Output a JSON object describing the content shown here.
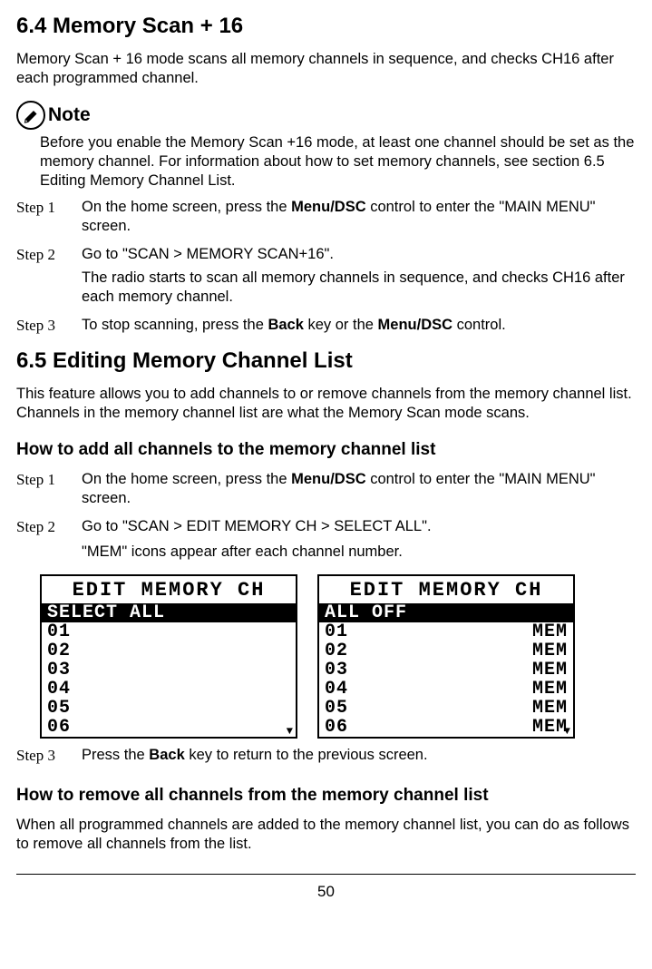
{
  "section64": {
    "heading": "6.4 Memory Scan + 16",
    "intro": "Memory Scan + 16 mode scans all memory channels in sequence, and checks CH16 after each programmed channel.",
    "note": {
      "label": "Note",
      "body": "Before you enable the Memory Scan +16 mode, at least one channel should be set as the memory channel. For information about how to set memory channels, see section 6.5 Editing Memory Channel List."
    },
    "steps": [
      {
        "label": "Step 1",
        "parts": [
          "On the home screen, press the ",
          "Menu/DSC",
          " control to enter the \"MAIN MENU\" screen."
        ]
      },
      {
        "label": "Step 2",
        "line1": "Go to \"SCAN > MEMORY SCAN+16\".",
        "line2": "The radio starts to scan all memory channels in sequence, and checks CH16 after each memory channel."
      },
      {
        "label": "Step 3",
        "parts": [
          "To stop scanning, press the ",
          "Back",
          " key or the ",
          "Menu/DSC",
          " control."
        ]
      }
    ]
  },
  "section65": {
    "heading": "6.5 Editing Memory Channel List",
    "intro": "This feature allows you to add channels to or remove channels from the memory channel list. Channels in the memory channel list are what the Memory Scan mode scans.",
    "addHeading": "How to add all channels to the memory channel list",
    "addSteps": [
      {
        "label": "Step 1",
        "parts": [
          "On the home screen, press the ",
          "Menu/DSC",
          " control to enter the \"MAIN MENU\" screen."
        ]
      },
      {
        "label": "Step 2",
        "line1": "Go to \"SCAN > EDIT MEMORY CH > SELECT ALL\".",
        "line2": "\"MEM\" icons appear after each channel number."
      }
    ],
    "screens": {
      "left": {
        "title": "EDIT MEMORY CH",
        "rows": [
          {
            "left": "SELECT ALL",
            "right": "",
            "selected": true
          },
          {
            "left": "01",
            "right": ""
          },
          {
            "left": "02",
            "right": ""
          },
          {
            "left": "03",
            "right": ""
          },
          {
            "left": "04",
            "right": ""
          },
          {
            "left": "05",
            "right": ""
          },
          {
            "left": "06",
            "right": ""
          }
        ]
      },
      "right": {
        "title": "EDIT MEMORY CH",
        "rows": [
          {
            "left": "ALL OFF",
            "right": "",
            "selected": true
          },
          {
            "left": "01",
            "right": "MEM"
          },
          {
            "left": "02",
            "right": "MEM"
          },
          {
            "left": "03",
            "right": "MEM"
          },
          {
            "left": "04",
            "right": "MEM"
          },
          {
            "left": "05",
            "right": "MEM"
          },
          {
            "left": "06",
            "right": "MEM"
          }
        ]
      }
    },
    "step3": {
      "label": "Step 3",
      "parts": [
        "Press the ",
        "Back",
        " key to return to the previous screen."
      ]
    },
    "removeHeading": "How to remove all channels from the memory channel list",
    "removeIntro": "When all programmed channels are added to the memory channel list, you can do as follows to remove all channels from the list."
  },
  "pageNumber": "50"
}
